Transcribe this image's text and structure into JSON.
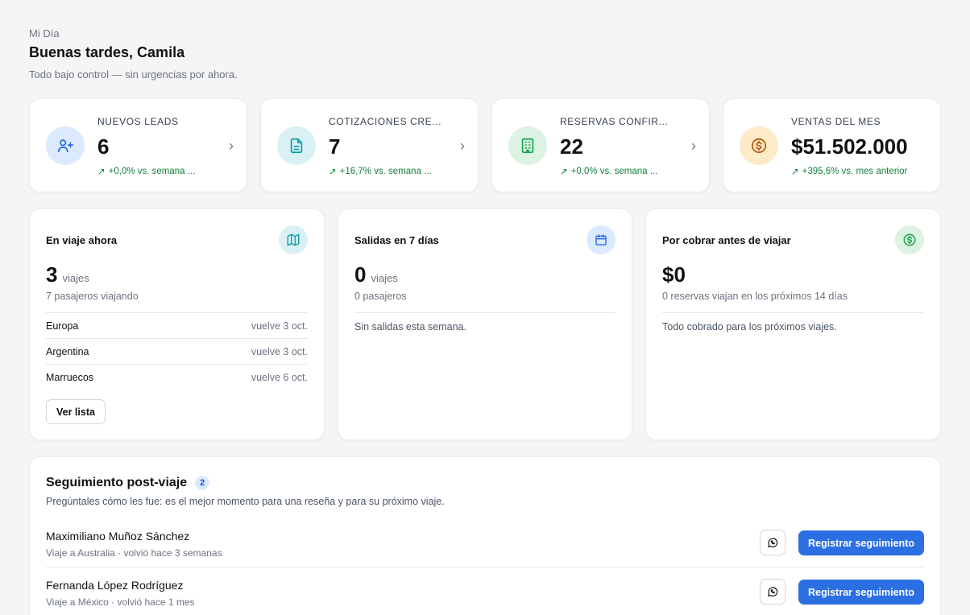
{
  "header": {
    "eyebrow": "Mi Día",
    "greeting": "Buenas tardes, Camila",
    "subtitle": "Todo bajo control — sin urgencias por ahora."
  },
  "stats": [
    {
      "label": "NUEVOS LEADS",
      "value": "6",
      "trend": "+0,0% vs. semana ...",
      "icon": "user-plus-icon",
      "color": "#dbeafe"
    },
    {
      "label": "COTIZACIONES CRE...",
      "value": "7",
      "trend": "+16,7% vs. semana ...",
      "icon": "document-icon",
      "color": "#d9f1f4"
    },
    {
      "label": "RESERVAS CONFIR...",
      "value": "22",
      "trend": "+0,0% vs. semana ...",
      "icon": "building-icon",
      "color": "#dcf2e3"
    },
    {
      "label": "VENTAS DEL MES",
      "value": "$51.502.000",
      "trend": "+395,6% vs. mes anterior",
      "icon": "dollar-coin-icon",
      "color": "#fdebc8"
    }
  ],
  "traveling": {
    "title": "En viaje ahora",
    "count": "3",
    "unit": "viajes",
    "sub": "7 pasajeros viajando",
    "trips": [
      {
        "destination": "Europa",
        "returns": "vuelve 3 oct."
      },
      {
        "destination": "Argentina",
        "returns": "vuelve 3 oct."
      },
      {
        "destination": "Marruecos",
        "returns": "vuelve 6 oct."
      }
    ],
    "button": "Ver lista"
  },
  "departures": {
    "title": "Salidas en 7 días",
    "count": "0",
    "unit": "viajes",
    "sub": "0 pasajeros",
    "note": "Sin salidas esta semana."
  },
  "receivables": {
    "title": "Por cobrar antes de viajar",
    "amount": "$0",
    "sub": "0 reservas viajan en los próximos 14 días",
    "note": "Todo cobrado para los próximos viajes."
  },
  "followup": {
    "title": "Seguimiento post-viaje",
    "count": "2",
    "description": "Pregúntales cómo les fue: es el mejor momento para una reseña y para su próximo viaje.",
    "items": [
      {
        "name": "Maximiliano Muñoz Sánchez",
        "meta": "Viaje a Australia · volvió hace 3 semanas",
        "button": "Registrar seguimiento"
      },
      {
        "name": "Fernanda López Rodríguez",
        "meta": "Viaje a México · volvió hace 1 mes",
        "button": "Registrar seguimiento"
      }
    ]
  },
  "colors": {
    "accent": "#2b6fe3",
    "positive": "#15803d",
    "map_icon_bg": "#d9f1f4",
    "calendar_icon_bg": "#dbeafe",
    "money_icon_bg": "#dcf2e3"
  }
}
